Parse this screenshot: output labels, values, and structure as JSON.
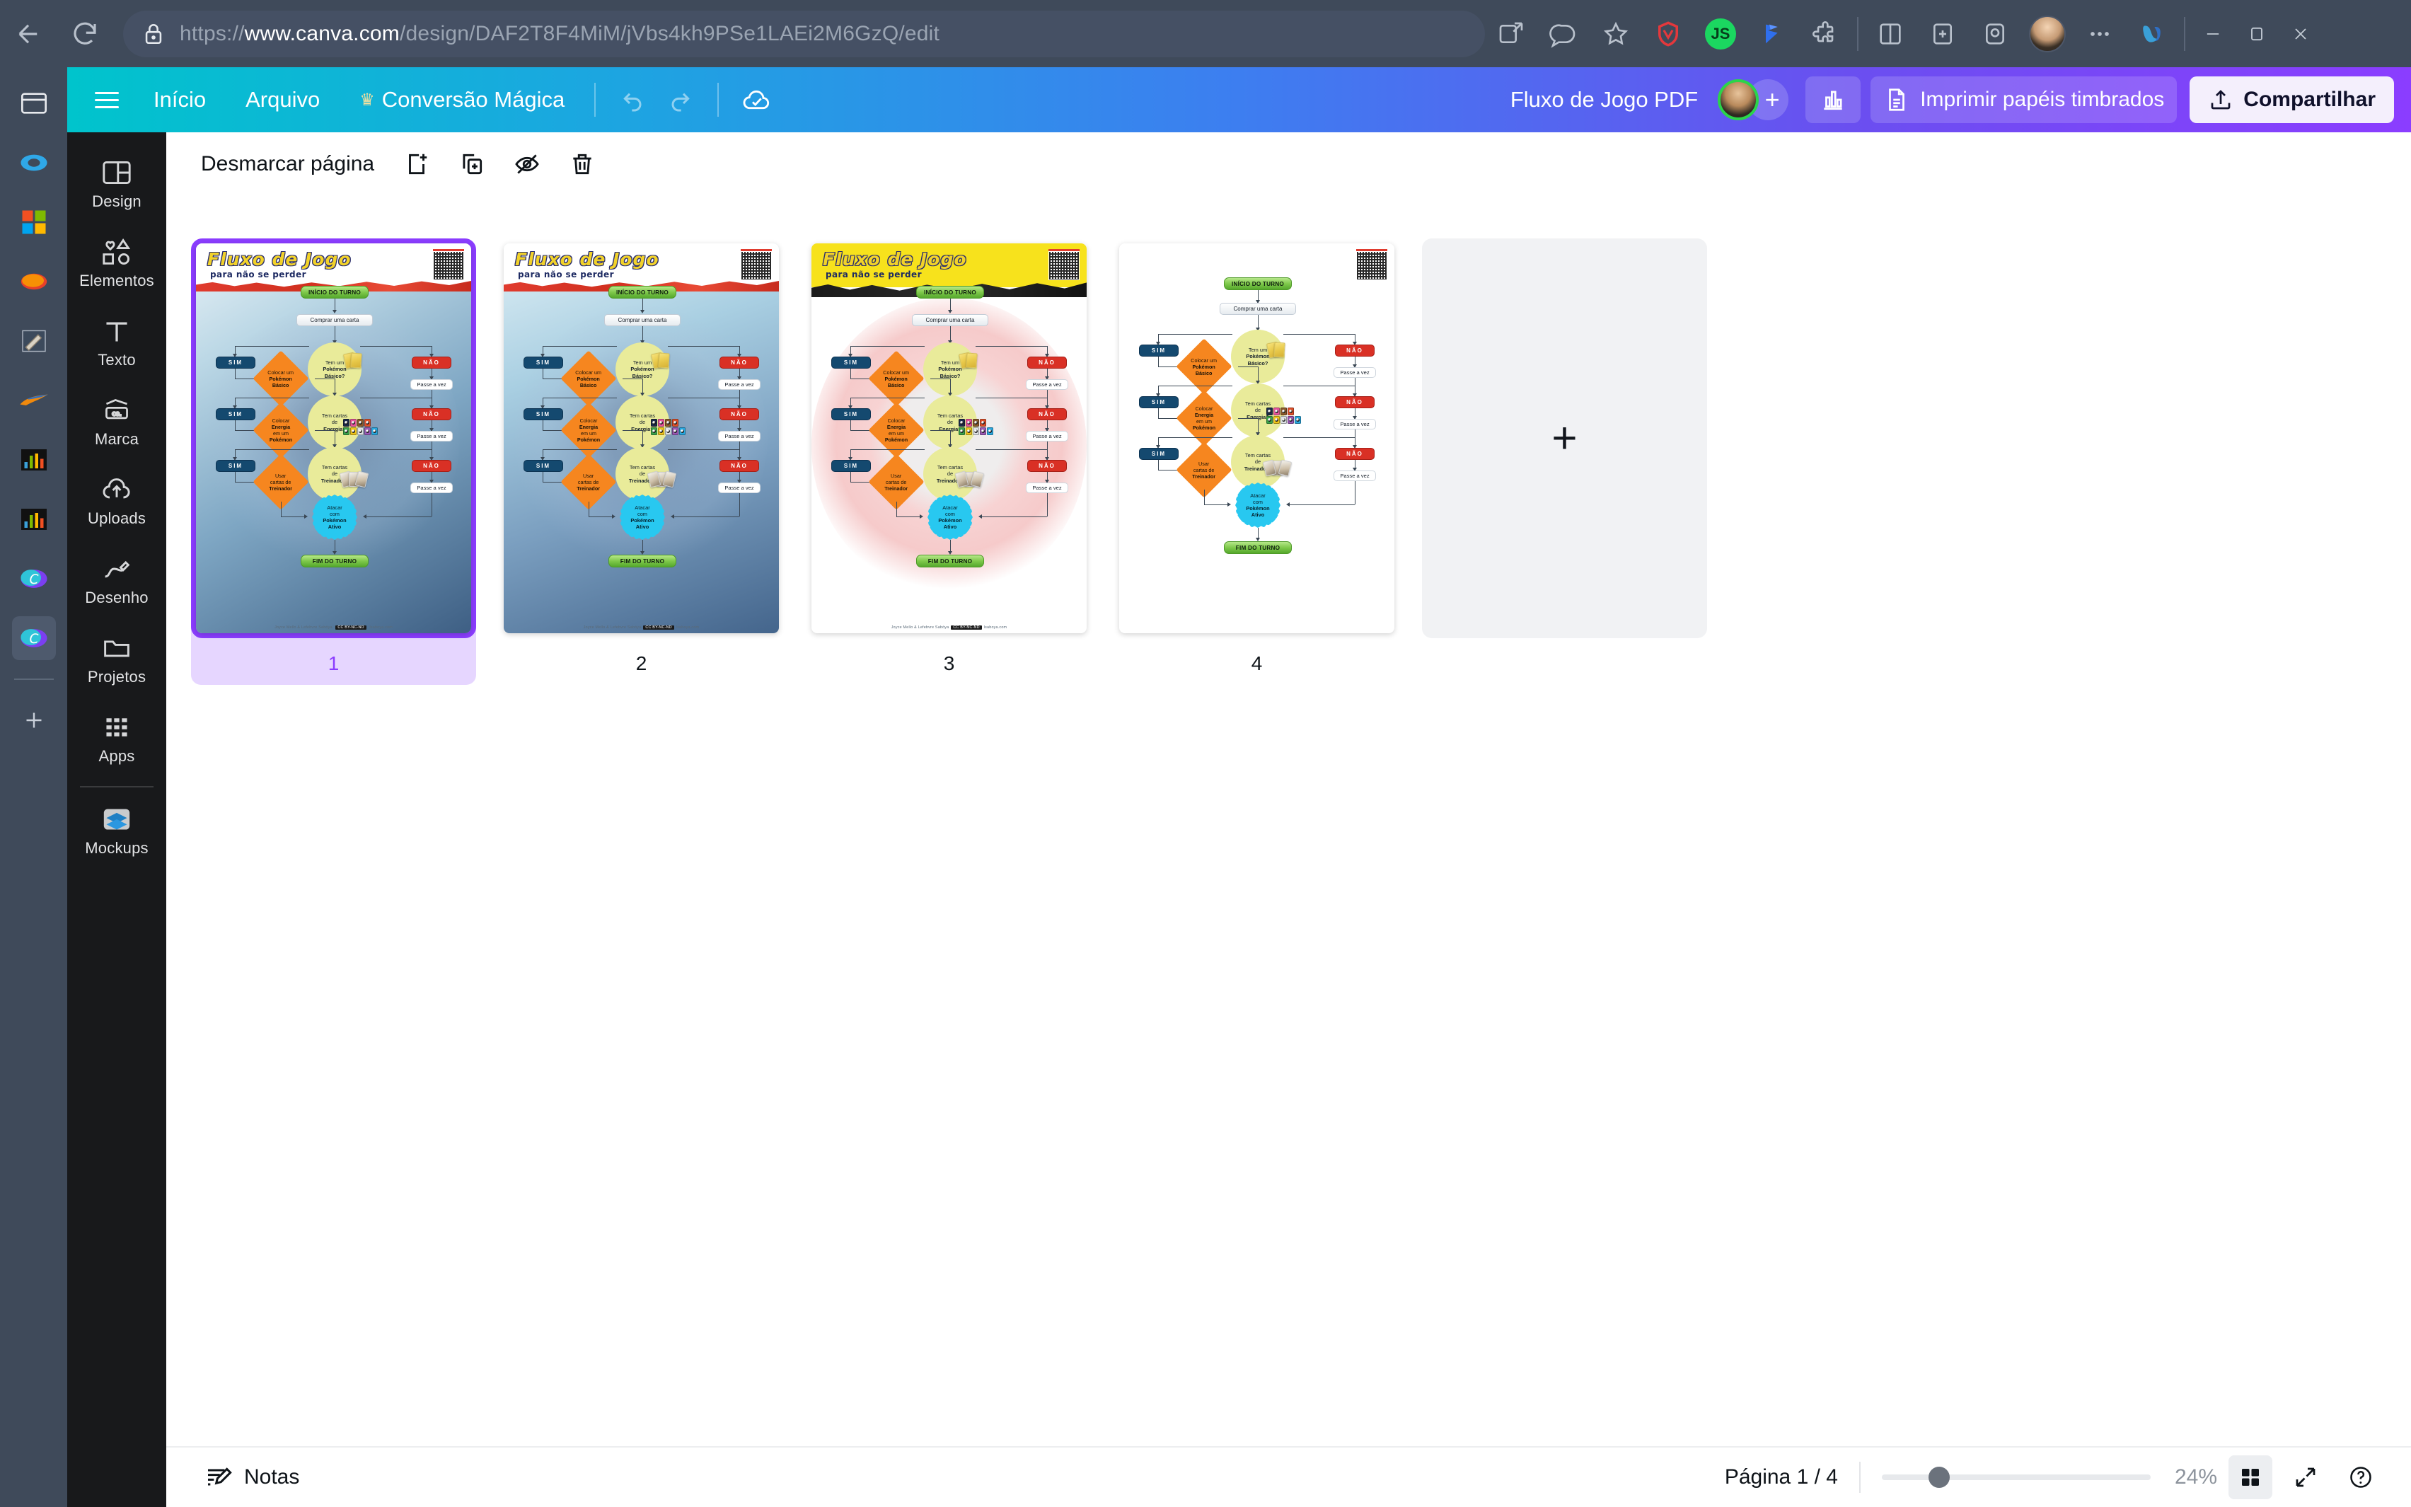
{
  "browser": {
    "url_display": "https://www.canva.com/design/DAF2T8F4MiM/jVbs4kh9PSe1LAEi2M6GzQ/edit",
    "url_protocol": "https://",
    "url_host": "www.canva.com",
    "url_path": "/design/DAF2T8F4MiM/jVbs4kh9PSe1LAEi2M6GzQ/edit",
    "nav": {
      "back": "back-arrow",
      "reload": "reload"
    },
    "extensions": [
      {
        "name": "vivaldi-shield-icon"
      },
      {
        "name": "javascript-toggle-icon",
        "label": "JS"
      },
      {
        "name": "pocket-icon"
      },
      {
        "name": "puzzle-extensions-icon"
      }
    ],
    "toolbar_icons": [
      {
        "name": "panel-split-icon"
      },
      {
        "name": "add-page-bookmark-icon"
      },
      {
        "name": "pocket-save-icon"
      },
      {
        "name": "profile-avatar"
      },
      {
        "name": "more-options-icon"
      },
      {
        "name": "microsoft-copilot-icon"
      }
    ],
    "window_controls": [
      "minimize",
      "maximize",
      "close"
    ],
    "tabstrip": [
      {
        "name": "window-tab-icon",
        "active": false
      },
      {
        "name": "vivaldi-tab-icon",
        "active": false
      },
      {
        "name": "microsoft-tab-icon",
        "active": false
      },
      {
        "name": "orange-ellipse-tab-icon",
        "active": false
      },
      {
        "name": "notepad-tab-icon",
        "active": false
      },
      {
        "name": "swoosh-tab-icon",
        "active": false
      },
      {
        "name": "chart-tab-icon-1",
        "active": false
      },
      {
        "name": "chart-tab-icon-2",
        "active": false
      },
      {
        "name": "canva-tab-icon-1",
        "active": false
      },
      {
        "name": "canva-tab-icon-2",
        "active": true
      },
      {
        "name": "new-tab-icon",
        "active": false
      }
    ]
  },
  "header": {
    "menu_home": "Início",
    "menu_file": "Arquivo",
    "menu_magic": "Conversão Mágica",
    "doc_title": "Fluxo de Jogo PDF",
    "print_label": "Imprimir papéis timbrados",
    "share_label": "Compartilhar",
    "icons": {
      "hamburger": "hamburger-menu-icon",
      "crown": "crown-icon",
      "undo": "undo-icon",
      "redo": "redo-icon",
      "cloud_saved": "cloud-saved-icon",
      "analytics": "analytics-bar-icon",
      "print_doc": "document-print-icon",
      "share_upload": "share-upload-icon"
    },
    "gradient": {
      "from": "#00c4cc",
      "mid": "#3d7ef0",
      "to": "#8b3dff"
    }
  },
  "sidebar": {
    "items": [
      {
        "label": "Design",
        "icon": "design-layout-icon"
      },
      {
        "label": "Elementos",
        "icon": "elements-shapes-icon"
      },
      {
        "label": "Texto",
        "icon": "text-t-icon"
      },
      {
        "label": "Marca",
        "icon": "brand-card-icon"
      },
      {
        "label": "Uploads",
        "icon": "upload-cloud-icon"
      },
      {
        "label": "Desenho",
        "icon": "draw-pen-icon"
      },
      {
        "label": "Projetos",
        "icon": "folder-projects-icon"
      },
      {
        "label": "Apps",
        "icon": "apps-grid-icon"
      },
      {
        "label": "Mockups",
        "icon": "mockups-layers-icon"
      }
    ]
  },
  "page_toolbar": {
    "unmark_label": "Desmarcar página",
    "icons": [
      {
        "name": "add-page-icon"
      },
      {
        "name": "duplicate-page-icon"
      },
      {
        "name": "hide-page-icon"
      },
      {
        "name": "delete-page-icon"
      }
    ]
  },
  "pages": [
    {
      "number": "1",
      "selected": true,
      "bg": "bg-blue",
      "banner": "white",
      "blob": "blob2"
    },
    {
      "number": "2",
      "selected": false,
      "bg": "bg-blue2",
      "banner": "white",
      "blob": "blob2"
    },
    {
      "number": "3",
      "selected": false,
      "bg": "bg-white",
      "banner": "yellow",
      "blob": "blob3"
    },
    {
      "number": "4",
      "selected": false,
      "bg": "bg-white",
      "banner": "none",
      "blob": "none"
    }
  ],
  "add_page": {
    "label": "+",
    "name": "add-page-placeholder"
  },
  "flowchart": {
    "title": "Fluxo de Jogo",
    "subtitle": "para não se perder",
    "start": "INÍCIO DO TURNO",
    "draw_card": "Comprar uma carta",
    "decisions": [
      {
        "line1": "Tem um",
        "line2": "Pokémon",
        "line3": "Básico?"
      },
      {
        "line1": "Tem cartas",
        "line2": "de",
        "line3": "Energia?"
      },
      {
        "line1": "Tem cartas",
        "line2": "de",
        "line3": "Treinador?"
      }
    ],
    "actions": [
      {
        "line1": "Colocar um",
        "line2": "Pokémon",
        "line3": "Básico"
      },
      {
        "line1": "Colocar",
        "line2": "Energia",
        "line3": "em um",
        "line4": "Pokémon"
      },
      {
        "line1": "Usar",
        "line2": "cartas de",
        "line3": "Treinador"
      }
    ],
    "yes_label": "SIM",
    "no_label": "NÃO",
    "pass_label": "Passe a vez",
    "attack": {
      "line1": "Atacar",
      "line2": "com",
      "line3": "Pokémon",
      "line4": "Ativo"
    },
    "end": "FIM DO TURNO",
    "credit_authors": "Joyce Mello & Lefebvre Sabóya",
    "credit_license": "CC BY-NC-ND",
    "credit_site": "lsaboya.com",
    "energy_row1": [
      "#1b2a4a",
      "#e8539e",
      "#8a5a2b",
      "#e0502a"
    ],
    "energy_row2": [
      "#3aa34a",
      "#f0c419",
      "#dfe3e6",
      "#9b59b6",
      "#29a8e0"
    ],
    "colors": {
      "start_end": "#7fc94b",
      "decision": "#e9eb9a",
      "action": "#f6861f",
      "yes": "#14496f",
      "no": "#d93025",
      "attack": "#28c8f0"
    }
  },
  "bottom": {
    "notes_label": "Notas",
    "notes_icon": "notes-pencil-icon",
    "page_counter": "Página 1 / 4",
    "zoom_level": "24%",
    "grid_icon": "grid-view-icon",
    "expand_icon": "fullscreen-expand-icon",
    "help_icon": "help-question-icon"
  }
}
